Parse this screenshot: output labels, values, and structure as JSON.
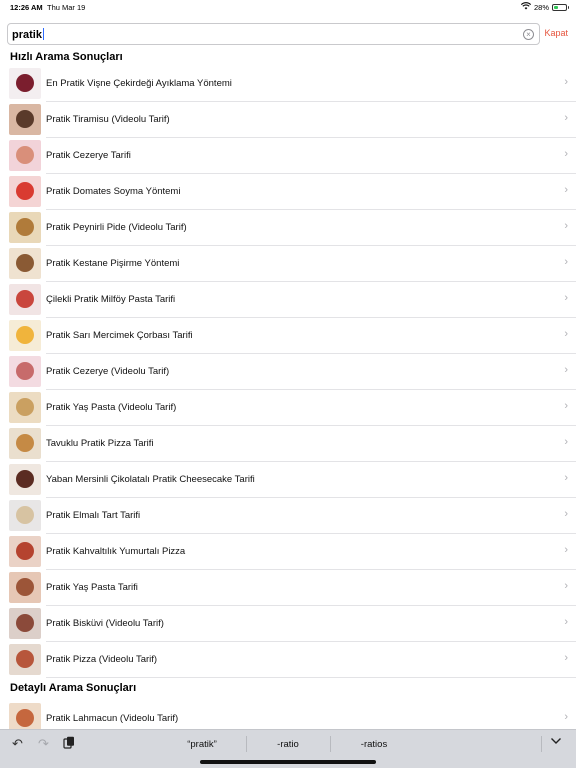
{
  "status_bar": {
    "time": "12:26 AM",
    "date": "Thu Mar 19",
    "battery": "28%",
    "battery_level": 0.28,
    "wifi_icon": "wifi-icon",
    "battery_icon": "battery-icon"
  },
  "search": {
    "value": "pratik",
    "clear_icon": "clear-icon",
    "close_label": "Kapat"
  },
  "quick_results": {
    "title": "Hızlı Arama Sonuçları",
    "items": [
      {
        "label": "En Pratik Vişne Çekirdeği Ayıklama Yöntemi",
        "bg": "#f3eef0",
        "plate": "#7b1e2e"
      },
      {
        "label": "Pratik Tiramisu (Videolu Tarif)",
        "bg": "#d9b7a3",
        "plate": "#5a3a2a"
      },
      {
        "label": "Pratik Cezerye Tarifi",
        "bg": "#f2d3d9",
        "plate": "#d98f7a"
      },
      {
        "label": "Pratik Domates Soyma Yöntemi",
        "bg": "#f4d4d4",
        "plate": "#d93b31"
      },
      {
        "label": "Pratik Peynirli Pide (Videolu Tarif)",
        "bg": "#e9d8b8",
        "plate": "#b07b3a"
      },
      {
        "label": "Pratik Kestane Pişirme Yöntemi",
        "bg": "#efe2d0",
        "plate": "#8a5a34"
      },
      {
        "label": "Çilekli Pratik Milföy Pasta Tarifi",
        "bg": "#f1e4e4",
        "plate": "#c9463d"
      },
      {
        "label": "Pratik Sarı Mercimek Çorbası Tarifi",
        "bg": "#f6ecd6",
        "plate": "#f0b43c"
      },
      {
        "label": "Pratik Cezerye (Videolu Tarif)",
        "bg": "#f3dbe1",
        "plate": "#c76b6b"
      },
      {
        "label": "Pratik Yaş Pasta (Videolu Tarif)",
        "bg": "#ecdcc2",
        "plate": "#caa061"
      },
      {
        "label": "Tavuklu Pratik Pizza Tarifi",
        "bg": "#eadfce",
        "plate": "#c58a45"
      },
      {
        "label": "Yaban Mersinli Çikolatalı Pratik Cheesecake Tarifi",
        "bg": "#efe7e0",
        "plate": "#5b2c22"
      },
      {
        "label": "Pratik Elmalı Tart Tarifi",
        "bg": "#e8e6e6",
        "plate": "#d7c3a2"
      },
      {
        "label": "Pratik Kahvaltılık Yumurtalı Pizza",
        "bg": "#ead2c6",
        "plate": "#b5432f"
      },
      {
        "label": "Pratik Yaş Pasta Tarifi",
        "bg": "#e6c7b5",
        "plate": "#9c5538"
      },
      {
        "label": "Pratik Bisküvi (Videolu Tarif)",
        "bg": "#dccfc9",
        "plate": "#8b4a3a"
      },
      {
        "label": "Pratik Pizza (Videolu Tarif)",
        "bg": "#e5d9cf",
        "plate": "#b7563b"
      }
    ]
  },
  "detailed_results": {
    "title": "Detaylı Arama Sonuçları",
    "items": [
      {
        "label": "Pratik Lahmacun (Videolu Tarif)",
        "bg": "#eedbc8",
        "plate": "#c5673e"
      }
    ]
  },
  "keyboard": {
    "undo_icon": "undo-icon",
    "redo_icon": "redo-icon",
    "paste_icon": "paste-icon",
    "suggestions": [
      "“pratik”",
      "-ratio",
      "-ratios"
    ],
    "collapse_icon": "chevron-down-icon"
  }
}
